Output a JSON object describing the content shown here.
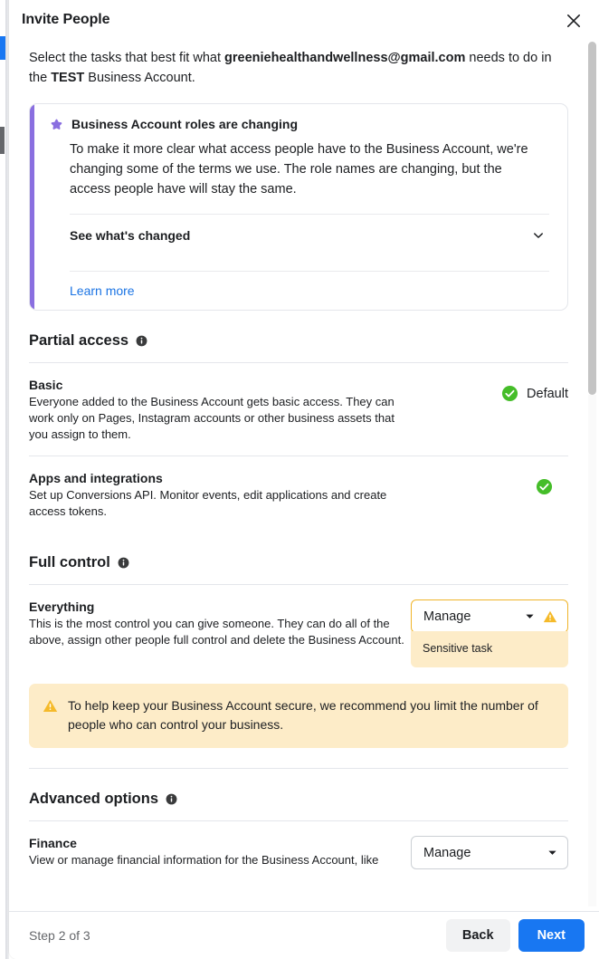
{
  "dialog": {
    "title": "Invite People",
    "close_icon": "close-icon",
    "lede": {
      "prefix": "Select the tasks that best fit what ",
      "email": "greeniehealthandwellness@gmail.com",
      "middle": " needs to do in the ",
      "account": "TEST",
      "suffix": " Business Account."
    }
  },
  "notice": {
    "icon": "star-icon",
    "accent_color": "#8a6fe0",
    "heading": "Business Account roles are changing",
    "body": "To make it more clear what access people have to the Business Account, we're changing some of the terms we use. The role names are changing, but the access people have will stay the same.",
    "expander_label": "See what's changed",
    "expander_icon": "chevron-down-icon",
    "link_label": "Learn more"
  },
  "sections": [
    {
      "title": "Partial access",
      "info_icon": "info-icon",
      "rows": [
        {
          "name": "Basic",
          "desc": "Everyone added to the Business Account gets basic access. They can work only on Pages, Instagram accounts or other business assets that you assign to them.",
          "control": "check-with-label",
          "check_label": "Default",
          "check_color": "#45bd29"
        },
        {
          "name": "Apps and integrations",
          "desc": "Set up Conversions API. Monitor events, edit applications and create access tokens.",
          "control": "check",
          "check_label": "",
          "check_color": "#45bd29"
        }
      ]
    },
    {
      "title": "Full control",
      "info_icon": "info-icon",
      "rows": [
        {
          "name": "Everything",
          "desc": "This is the most control you can give someone. They can do all of the above, assign other people full control and delete the Business Account.",
          "control": "dropdown-warning",
          "dropdown_value": "Manage",
          "dropdown_caret": "chevron-down-icon",
          "warning_icon": "warning-triangle-icon",
          "note": "Sensitive task",
          "note_bg": "#fdecc8"
        }
      ],
      "banner": {
        "icon": "warning-triangle-icon",
        "text": "To help keep your Business Account secure, we recommend you limit the number of people who can control your business.",
        "bg": "#fdecc8"
      }
    },
    {
      "title": "Advanced options",
      "info_icon": "info-icon",
      "rows": [
        {
          "name": "Finance",
          "desc": "View or manage financial information for the Business Account, like",
          "control": "dropdown",
          "dropdown_value": "Manage",
          "dropdown_caret": "chevron-down-icon"
        }
      ]
    }
  ],
  "footer": {
    "step_text": "Step 2 of 3",
    "back_label": "Back",
    "next_label": "Next",
    "next_color": "#1877f2"
  }
}
